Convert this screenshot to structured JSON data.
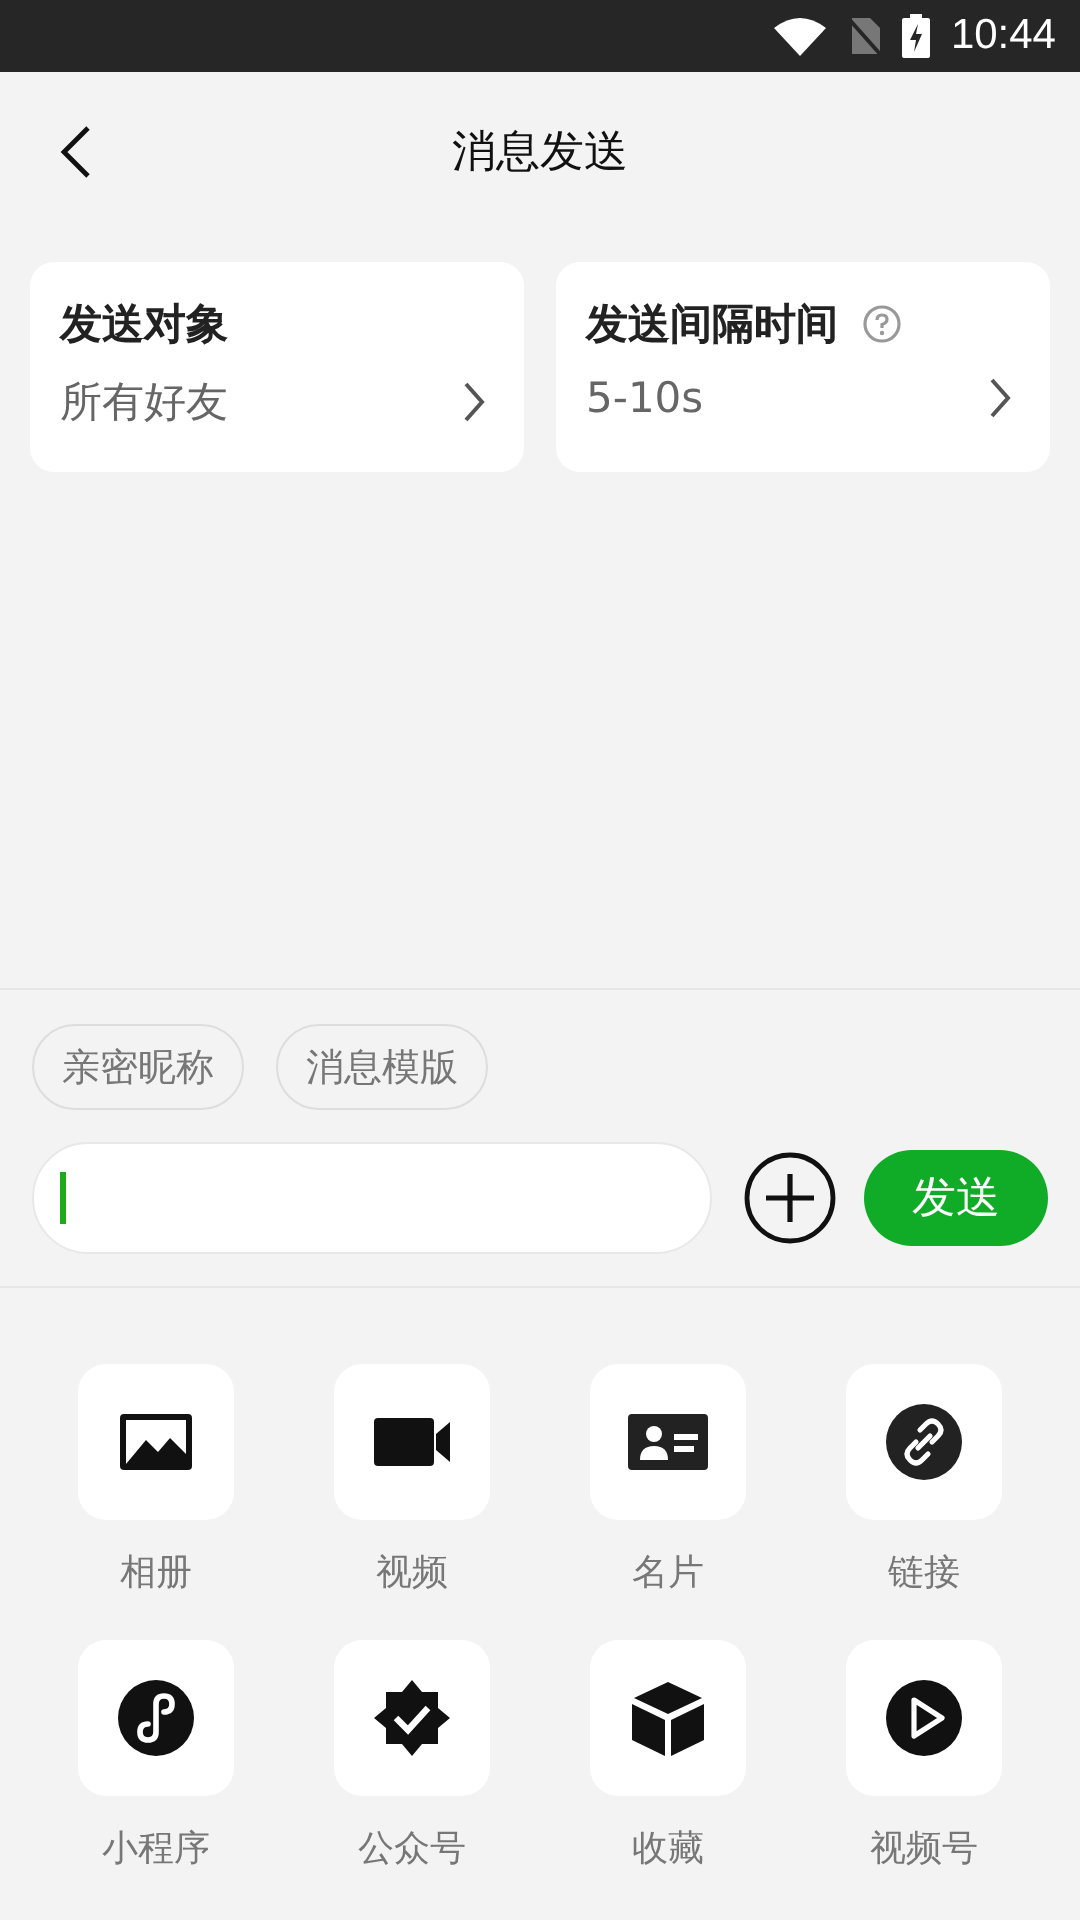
{
  "status_bar": {
    "time": "10:44"
  },
  "header": {
    "title": "消息发送"
  },
  "settings": [
    {
      "title": "发送对象",
      "value": "所有好友",
      "help": false
    },
    {
      "title": "发送间隔时间",
      "value": "5-10s",
      "help": true
    }
  ],
  "chips": [
    "亲密昵称",
    "消息模版"
  ],
  "composer": {
    "send": "发送"
  },
  "attachments": [
    {
      "kind": "photo",
      "label": "相册"
    },
    {
      "kind": "video",
      "label": "视频"
    },
    {
      "kind": "card",
      "label": "名片"
    },
    {
      "kind": "link",
      "label": "链接"
    },
    {
      "kind": "miniprogram",
      "label": "小程序"
    },
    {
      "kind": "official",
      "label": "公众号"
    },
    {
      "kind": "favorite",
      "label": "收藏"
    },
    {
      "kind": "channels",
      "label": "视频号"
    }
  ]
}
